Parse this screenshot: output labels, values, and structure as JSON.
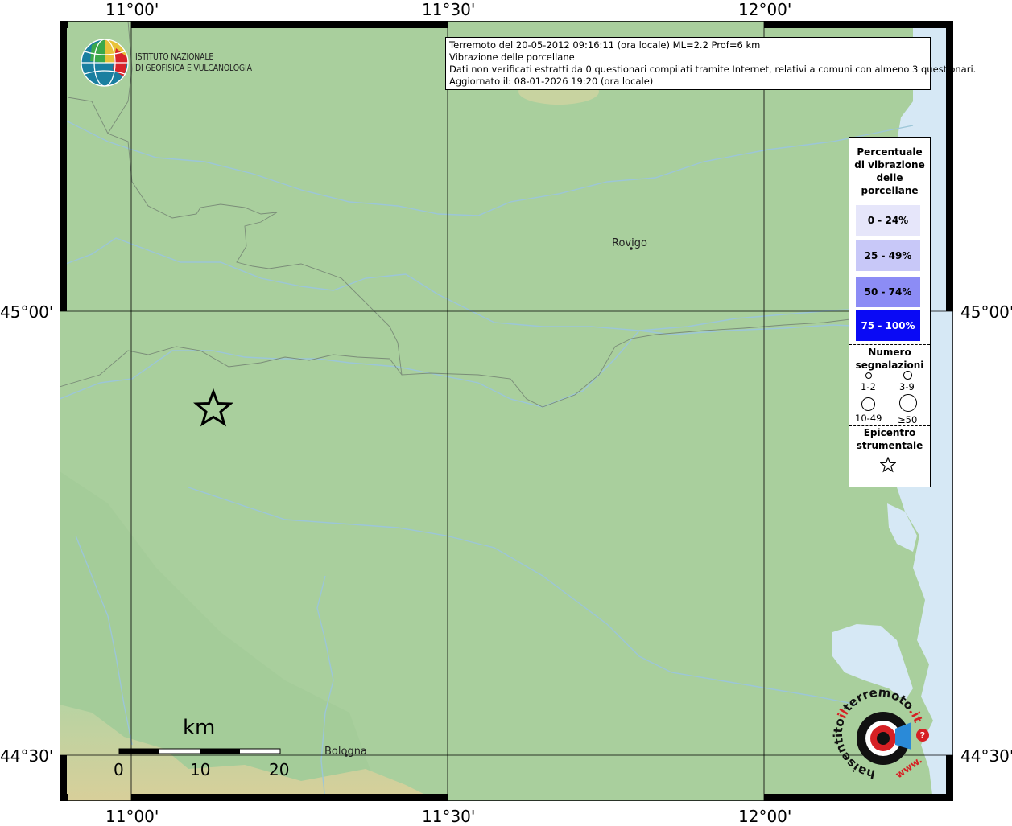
{
  "axis": {
    "top_labels": [
      "11°00'",
      "11°30'",
      "12°00'"
    ],
    "bottom_labels": [
      "11°00'",
      "11°30'",
      "12°00'"
    ],
    "left_labels": [
      "45°00'",
      "44°30'"
    ],
    "right_labels": [
      "45°00'",
      "44°30'"
    ]
  },
  "info": {
    "line1": "Terremoto del 20-05-2012 09:16:11 (ora locale) ML=2.2 Prof=6 km",
    "line2": "Vibrazione delle porcellane",
    "line3": "Dati non verificati estratti da 0 questionari compilati tramite Internet, relativi a comuni con almeno 3 questionari.",
    "line4": "Aggiornato il: 08-01-2026 19:20 (ora locale)"
  },
  "logo": {
    "line1": "ISTITUTO NAZIONALE",
    "line2": "DI GEOFISICA E VULCANOLOGIA"
  },
  "cities": {
    "rovigo": "Rovigo",
    "bologna": "Bologna"
  },
  "scale": {
    "unit": "km",
    "ticks": [
      "0",
      "10",
      "20"
    ]
  },
  "legend": {
    "title1": "Percentuale",
    "title2": "di vibrazione",
    "title3": "delle",
    "title4": "porcellane",
    "classes": [
      {
        "label": "0 - 24%",
        "color": "#e6e6fa"
      },
      {
        "label": "25 - 49%",
        "color": "#c8c8f8"
      },
      {
        "label": "50 - 74%",
        "color": "#8c8cf5"
      },
      {
        "label": "75 - 100%",
        "color": "#0a0af5"
      }
    ],
    "count_title1": "Numero",
    "count_title2": "segnalazioni",
    "counts": [
      "1-2",
      "3-9",
      "10-49",
      "≥50"
    ],
    "epi_title1": "Epicentro",
    "epi_title2": "strumentale"
  },
  "badge": {
    "text": "www.haisentitoilterremoto.it",
    "part1": "haisentito",
    "part2": "il",
    "part3": "terremoto",
    "part4": ".it",
    "part5": "www."
  },
  "colors": {
    "land": "#a9cf9d",
    "sea": "#d6e8f5",
    "river": "#9cc6d8",
    "border": "#7a8c78"
  }
}
